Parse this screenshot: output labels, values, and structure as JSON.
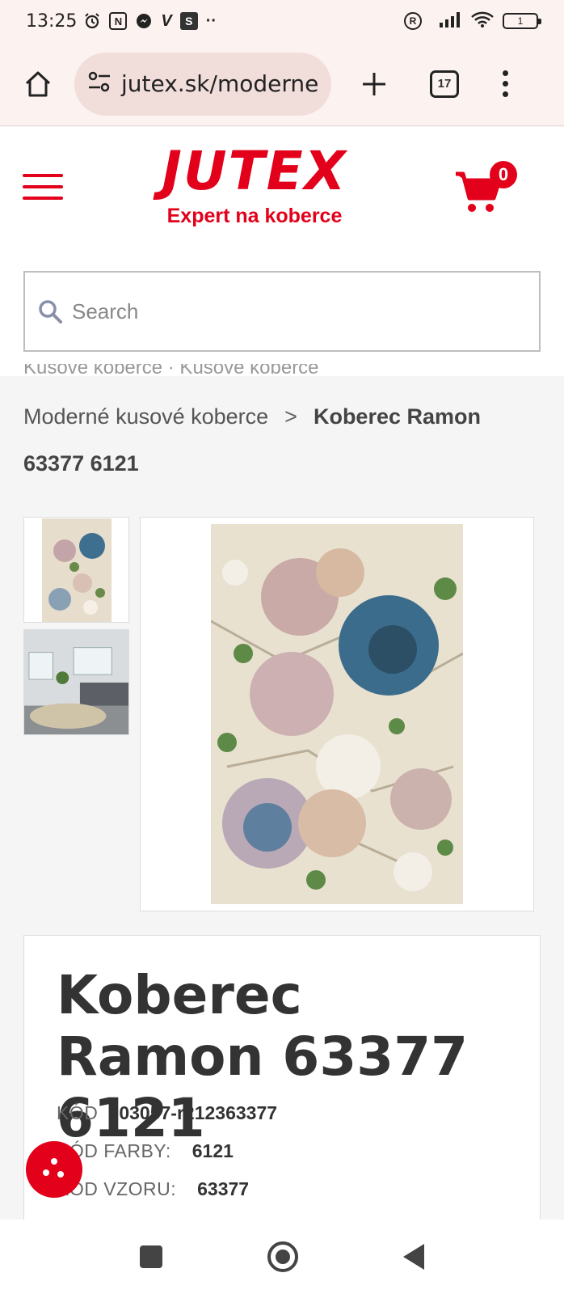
{
  "status_bar": {
    "time": "13:25",
    "icons": [
      "alarm-icon",
      "nfc-icon",
      "messenger-icon",
      "v-app-icon",
      "s-app-icon",
      "more-dots-icon"
    ],
    "v_label": "V",
    "s_label": "S",
    "dots": "··",
    "registered": "R",
    "battery": "1"
  },
  "browser": {
    "url": "jutex.sk/moderne",
    "tab_count": "17"
  },
  "header": {
    "logo_text": "JUTEX",
    "logo_tagline": "Expert na koberce",
    "cart_count": "0",
    "brand_color": "#e2001a",
    "search_placeholder": "Search"
  },
  "breadcrumb": {
    "clipped_text": "Kusové koberce · Kusové koberce",
    "parent": "Moderné kusové koberce",
    "separator": ">",
    "current": "Koberec Ramon 63377 6121"
  },
  "product": {
    "title": "Koberec Ramon 63377 6121",
    "specs": [
      {
        "label": "KÓD",
        "value": "03057-r212363377"
      },
      {
        "label": "KÓD FARBY:",
        "value": "6121"
      },
      {
        "label": "KÓD VZORU:",
        "value": "63377"
      }
    ]
  }
}
